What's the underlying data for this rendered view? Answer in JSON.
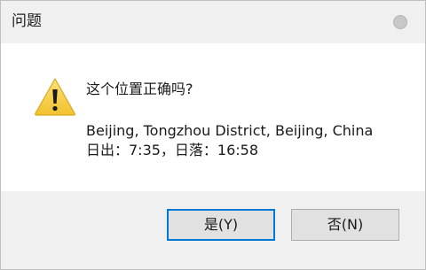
{
  "window": {
    "title": "问题"
  },
  "message": {
    "question": "这个位置正确吗?",
    "location": "Beijing, Tongzhou District, Beijing, China",
    "sun_times": "日出：7:35，日落：16:58"
  },
  "buttons": {
    "yes_label": "是(Y)",
    "no_label": "否(N)"
  },
  "icons": {
    "warning": "warning-icon",
    "close": "close-icon"
  },
  "colors": {
    "titlebar": "#f0f0f0",
    "footer": "#f0f0f0",
    "default_button_border": "#0078d7",
    "warning_fill": "#f7d04a"
  }
}
